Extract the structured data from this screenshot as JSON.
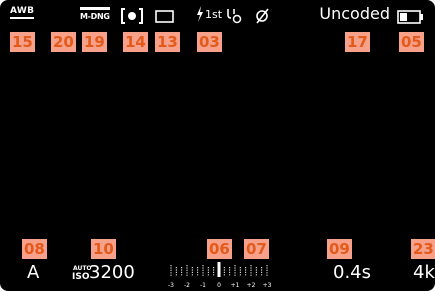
{
  "status_bar": {
    "white_balance": "AWB",
    "file_format": "M-DNG",
    "flash_label": "1st",
    "lens_status": "Uncoded"
  },
  "bottom_bar": {
    "exposure_mode": "A",
    "iso_prefix_top": "AUTO",
    "iso_prefix_bottom": "ISO",
    "iso_value": "3200",
    "shutter_speed": "0.4s",
    "resolution": "4k",
    "exposure_scale_labels": [
      "-3",
      "-2",
      "-1",
      "0",
      "+1",
      "+2",
      "+3"
    ],
    "exposure_value": 0
  },
  "callouts": {
    "white_balance": "15",
    "unused_20": "20",
    "file_format": "19",
    "metering": "14",
    "drive_mode": "13",
    "flash": "03",
    "lens": "17",
    "battery": "05",
    "exposure_mode": "08",
    "iso": "10",
    "exposure_scale": "06",
    "exposure_comp": "07",
    "shutter_speed": "09",
    "resolution": "23"
  },
  "colors": {
    "screen_bg": "#000000",
    "callout_bg": "#f7a08a",
    "callout_text": "#e35a1a",
    "display_text": "#ffffff"
  }
}
